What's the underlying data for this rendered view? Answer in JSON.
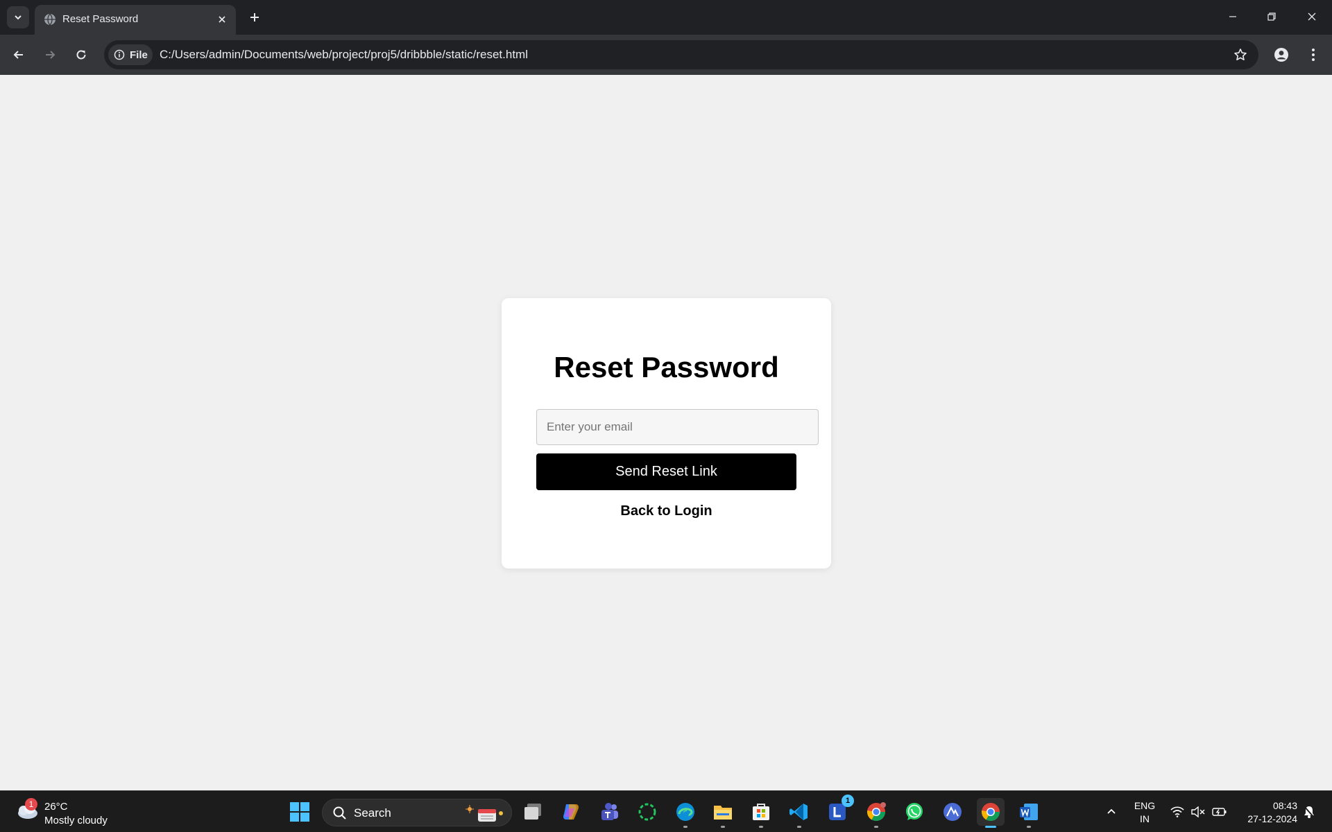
{
  "browser": {
    "tab_title": "Reset Password",
    "site_info_label": "File",
    "url": "C:/Users/admin/Documents/web/project/proj5/dribbble/static/reset.html"
  },
  "page": {
    "heading": "Reset Password",
    "email_placeholder": "Enter your email",
    "email_value": "",
    "send_button_label": "Send Reset Link",
    "back_link_label": "Back to Login"
  },
  "taskbar": {
    "weather_badge": "1",
    "temperature": "26°C",
    "condition": "Mostly cloudy",
    "search_label": "Search",
    "lens_badge": "1",
    "lang_line1": "ENG",
    "lang_line2": "IN",
    "time": "08:43",
    "date": "27-12-2024"
  },
  "colors": {
    "page_background": "#f0f0f0",
    "card_background": "#ffffff",
    "button_background": "#000000",
    "chrome_dark": "#202124",
    "chrome_toolbar": "#35363a",
    "taskbar": "#1c1c1c"
  }
}
